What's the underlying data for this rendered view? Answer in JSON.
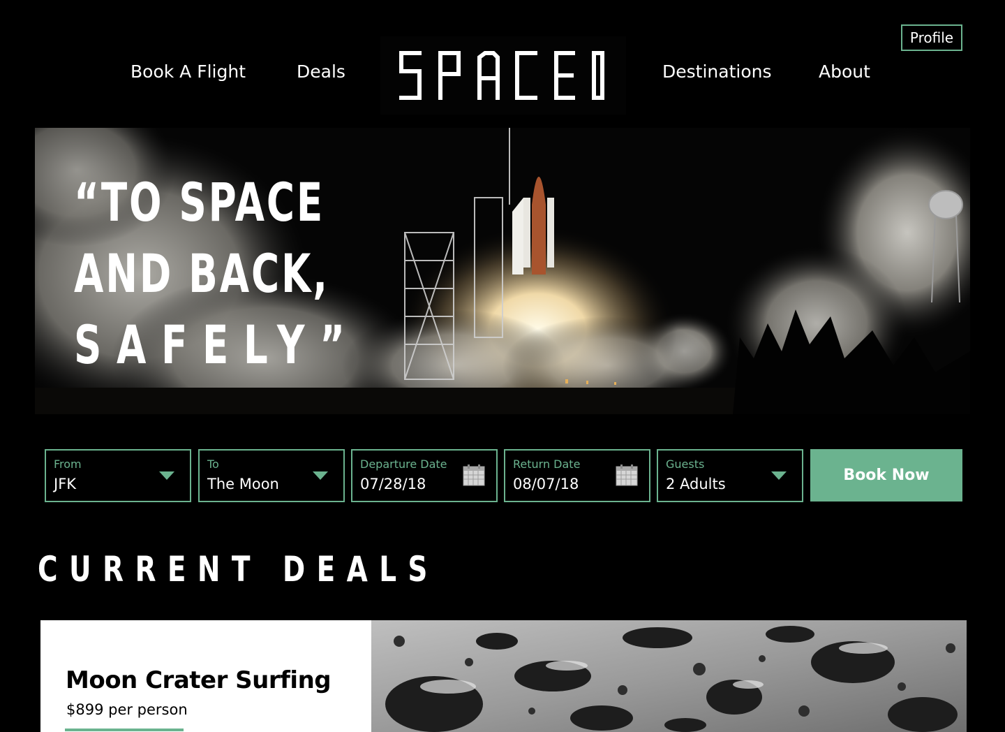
{
  "header": {
    "nav_left": [
      "Book A Flight",
      "Deals"
    ],
    "nav_right": [
      "Destinations",
      "About"
    ],
    "logo_text": "SPACED",
    "profile_label": "Profile"
  },
  "hero": {
    "quote_lines": [
      "“TO SPACE",
      "AND BACK,",
      "SAFELY”"
    ]
  },
  "booking": {
    "fields": [
      {
        "label": "From",
        "value": "JFK",
        "icon": "chevron-down-icon"
      },
      {
        "label": "To",
        "value": "The Moon",
        "icon": "chevron-down-icon"
      },
      {
        "label": "Departure Date",
        "value": "07/28/18",
        "icon": "calendar-icon"
      },
      {
        "label": "Return Date",
        "value": "08/07/18",
        "icon": "calendar-icon"
      },
      {
        "label": "Guests",
        "value": "2 Adults",
        "icon": "chevron-down-icon"
      }
    ],
    "book_label": "Book Now"
  },
  "deals": {
    "section_title": "CURRENT DEALS",
    "items": [
      {
        "title": "Moon Crater Surfing",
        "price": "$899 per person"
      }
    ]
  },
  "colors": {
    "accent": "#6bb38f",
    "background": "#000000",
    "card": "#ffffff"
  }
}
